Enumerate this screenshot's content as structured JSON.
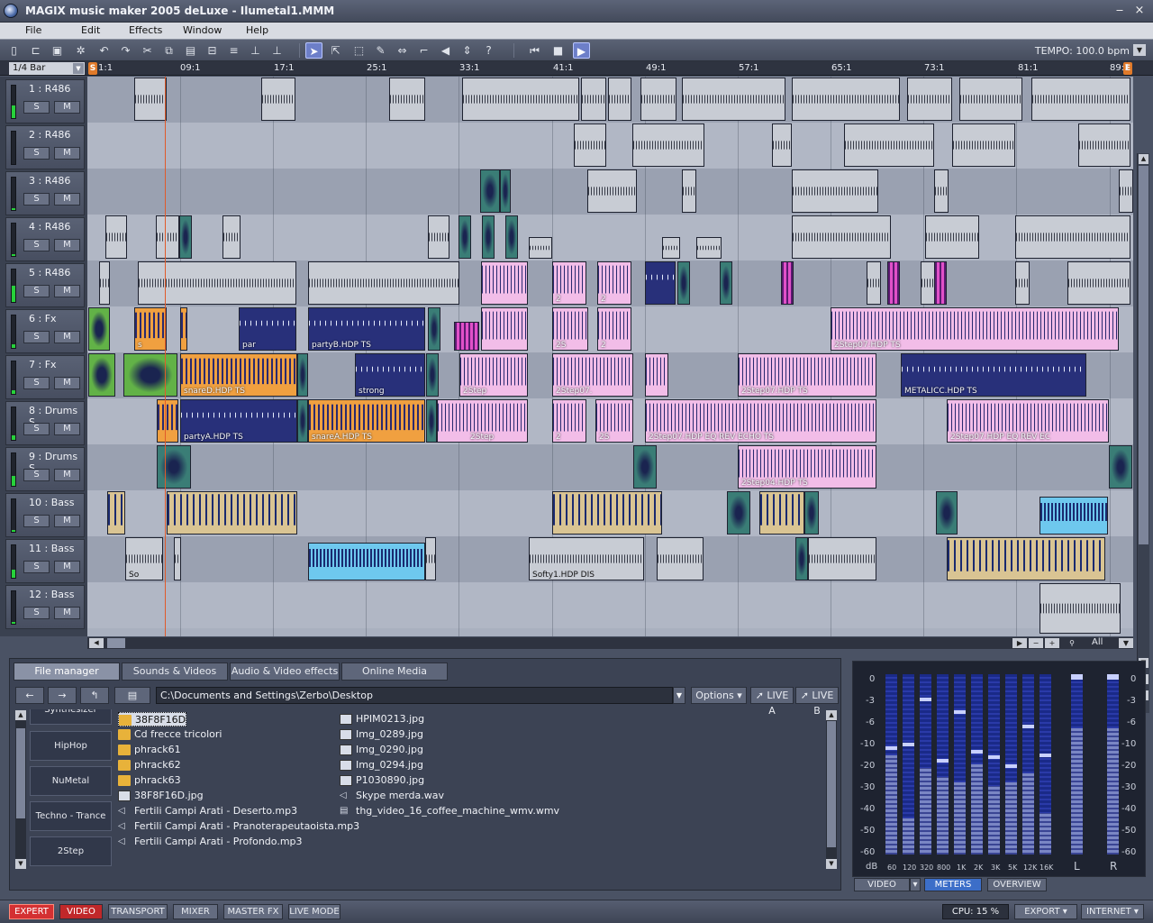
{
  "window": {
    "title": "MAGIX music maker 2005 deLuxe - Ilumetal1.MMM",
    "min_glyph": "‒",
    "close_glyph": "×"
  },
  "menu": [
    "File",
    "Edit",
    "Effects",
    "Window",
    "Help"
  ],
  "toolbar": {
    "icons": [
      "new-icon",
      "open-icon",
      "save-icon",
      "settings-icon",
      "undo-icon",
      "redo-icon",
      "cut-icon",
      "copy-icon",
      "paste-icon",
      "delete-icon",
      "align-icon",
      "mixer-icon",
      "mouse-arrow-icon",
      "range-icon",
      "marquee-icon",
      "pencil-icon",
      "stretch-icon",
      "split-icon",
      "resize-icon",
      "volume-icon",
      "help-cursor-icon",
      "rewind-icon",
      "stop-icon",
      "play-icon"
    ],
    "tempo_label": "TEMPO: 100.0 bpm"
  },
  "ruler": {
    "snap": "1/4 Bar",
    "start_marker": "S",
    "end_marker": "E",
    "ticks": [
      "1:1",
      "09:1",
      "17:1",
      "25:1",
      "33:1",
      "41:1",
      "49:1",
      "57:1",
      "65:1",
      "73:1",
      "81:1",
      "89:1"
    ]
  },
  "tracks": [
    {
      "name": "1 : R486",
      "level": 0.4
    },
    {
      "name": "2 : R486",
      "level": 0.0
    },
    {
      "name": "3 : R486",
      "level": 0.05
    },
    {
      "name": "4 : R486",
      "level": 0.05
    },
    {
      "name": "5 : R486",
      "level": 0.5
    },
    {
      "name": "6 : Fx",
      "level": 0.1
    },
    {
      "name": "7 : Fx",
      "level": 0.1
    },
    {
      "name": "8 : Drums S",
      "level": 0.15
    },
    {
      "name": "9 : Drums S",
      "level": 0.3
    },
    {
      "name": "10 : Bass",
      "level": 0.05
    },
    {
      "name": "11 : Bass",
      "level": 0.25
    },
    {
      "name": "12 : Bass",
      "level": 0.05
    }
  ],
  "track_buttons": {
    "solo": "S",
    "mute": "M"
  },
  "clip_labels": {
    "t5_a": "2",
    "t5_b": "2",
    "t6_a": "s",
    "t6_b": "par",
    "t6_c": "partyB.HDP  TS",
    "t6_d": "2S",
    "t6_e": "2",
    "t6_f": "2Step07.HDP  TS",
    "t7_a": "snareD.HDP  TS",
    "t7_b": "strong",
    "t7_c": "2Step",
    "t7_d": "2Step07.",
    "t7_e": "2Step07.HDP  TS",
    "t7_f": "METALICC.HDP  TS",
    "t8_a": "partyA.HDP  TS",
    "t8_b": "snareA.HDP  TS",
    "t8_c": "2Step",
    "t8_d": "2",
    "t8_e": "2S",
    "t8_f": "2Step07.HDP  EQ  REV  ECHO  TS",
    "t8_g": "2Step07.HDP  EQ  REV  EC",
    "t9_a": "2Step04.HDP  TS",
    "t11_a": "So",
    "t11_b": "Softy1.HDP  DIS"
  },
  "zoom": {
    "all_label": "All"
  },
  "pool": {
    "tabs": [
      "File manager",
      "Sounds & Videos",
      "Audio & Video effects",
      "Online Media"
    ],
    "nav": {
      "back": "←",
      "forward": "→",
      "up": "↰",
      "view": "▤",
      "options": "Options",
      "live_a": "LIVE A",
      "live_b": "LIVE B"
    },
    "path": "C:\\Documents and Settings\\Zerbo\\Desktop",
    "categories": [
      "Synthesizer",
      "HipHop",
      "NuMetal",
      "Techno - Trance",
      "2Step"
    ],
    "files_col1": [
      {
        "name": "38F8F16D",
        "type": "folder",
        "selected": true
      },
      {
        "name": "Cd frecce tricolori",
        "type": "folder"
      },
      {
        "name": "phrack61",
        "type": "folder"
      },
      {
        "name": "phrack62",
        "type": "folder"
      },
      {
        "name": "phrack63",
        "type": "folder"
      },
      {
        "name": "38F8F16D.jpg",
        "type": "image"
      },
      {
        "name": "Fertili Campi Arati - Deserto.mp3",
        "type": "audio"
      },
      {
        "name": "Fertili Campi Arati - Pranoterapeutaoista.mp3",
        "type": "audio"
      },
      {
        "name": "Fertili Campi Arati - Profondo.mp3",
        "type": "audio"
      }
    ],
    "files_col2": [
      {
        "name": "HPIM0213.jpg",
        "type": "image"
      },
      {
        "name": "Img_0289.jpg",
        "type": "image"
      },
      {
        "name": "Img_0290.jpg",
        "type": "image"
      },
      {
        "name": "Img_0294.jpg",
        "type": "image"
      },
      {
        "name": "P1030890.jpg",
        "type": "image"
      },
      {
        "name": "Skype merda.wav",
        "type": "audio"
      },
      {
        "name": "thg_video_16_coffee_machine_wmv.wmv",
        "type": "video"
      }
    ]
  },
  "meters": {
    "db_scale": [
      "0",
      "-3",
      "-6",
      "-10",
      "-20",
      "-30",
      "-40",
      "-50",
      "-60"
    ],
    "db_unit": "dB",
    "bands": [
      {
        "freq": "60",
        "level": 0.55,
        "peak": 0.6
      },
      {
        "freq": "120",
        "level": 0.2,
        "peak": 0.62
      },
      {
        "freq": "320",
        "level": 0.48,
        "peak": 0.87
      },
      {
        "freq": "800",
        "level": 0.43,
        "peak": 0.53
      },
      {
        "freq": "1K",
        "level": 0.4,
        "peak": 0.8
      },
      {
        "freq": "2K",
        "level": 0.5,
        "peak": 0.58
      },
      {
        "freq": "3K",
        "level": 0.38,
        "peak": 0.55
      },
      {
        "freq": "5K",
        "level": 0.4,
        "peak": 0.5
      },
      {
        "freq": "12K",
        "level": 0.45,
        "peak": 0.72
      },
      {
        "freq": "16K",
        "level": 0.23,
        "peak": 0.56
      }
    ],
    "left": {
      "label": "L",
      "level": 0.7
    },
    "right": {
      "label": "R",
      "level": 0.7
    },
    "tabs": [
      "VIDEO",
      "METERS",
      "OVERVIEW"
    ]
  },
  "status": {
    "buttons": [
      "EXPERT",
      "VIDEO",
      "TRANSPORT",
      "MIXER",
      "MASTER FX",
      "LIVE MODE"
    ],
    "cpu": "CPU: 15 %",
    "export": "EXPORT",
    "internet": "INTERNET"
  }
}
